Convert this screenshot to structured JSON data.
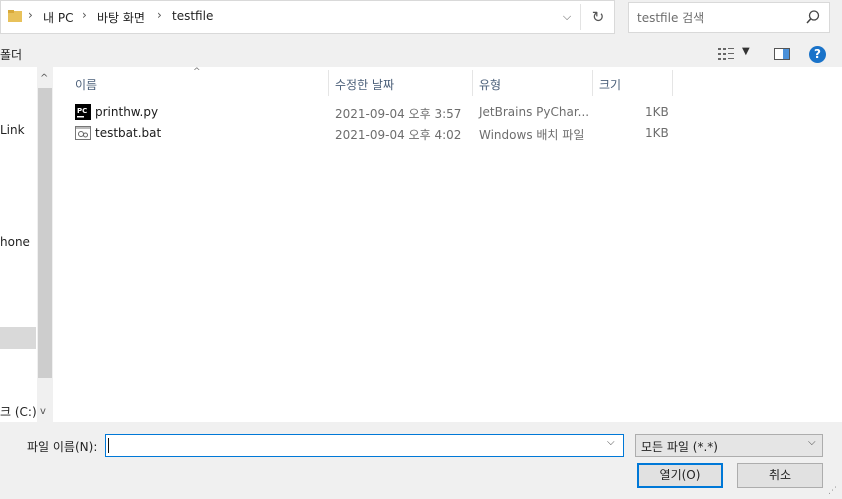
{
  "address": {
    "crumbs": [
      "내 PC",
      "바탕 화면",
      "testfile"
    ],
    "separator": "›",
    "dropdown_glyph": "⌵",
    "refresh_glyph": "↻"
  },
  "search": {
    "placeholder": "testfile 검색"
  },
  "toolbar": {
    "new_folder_partial": "폴더"
  },
  "nav": {
    "items": [
      {
        "label": "Link"
      },
      {
        "label": "hone"
      },
      {
        "label": "크 (C:)"
      }
    ]
  },
  "columns": [
    "이름",
    "수정한 날짜",
    "유형",
    "크기"
  ],
  "files": [
    {
      "name": "printhw.py",
      "date": "2021-09-04 오후 3:57",
      "type": "JetBrains PyChar...",
      "size": "1KB",
      "icon": "pycharm-file-icon"
    },
    {
      "name": "testbat.bat",
      "date": "2021-09-04 오후 4:02",
      "type": "Windows 배치 파일",
      "size": "1KB",
      "icon": "batch-file-icon"
    }
  ],
  "bottom": {
    "filename_label": "파일 이름(N):",
    "filename_value": "",
    "filetype": "모든 파일 (*.*)",
    "open_label": "열기(O)",
    "cancel_label": "취소"
  },
  "colors": {
    "accent": "#0078d7",
    "help": "#1a73c9",
    "header_text": "#4c607a"
  }
}
